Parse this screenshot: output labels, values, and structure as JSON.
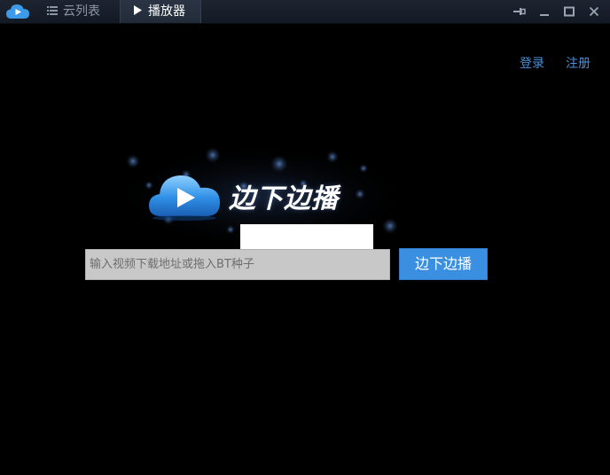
{
  "titlebar": {
    "logo_icon": "cloud-play-icon",
    "tabs": [
      {
        "label": "云列表",
        "icon": "list-icon",
        "active": false
      },
      {
        "label": "播放器",
        "icon": "play-icon",
        "active": true
      }
    ],
    "window_controls": [
      "pin-icon",
      "minimize-icon",
      "maximize-icon",
      "close-icon"
    ]
  },
  "header": {
    "login_label": "登录",
    "register_label": "注册"
  },
  "brand": {
    "logo_icon": "cloud-play-icon",
    "name": "边下边播"
  },
  "search": {
    "placeholder": "输入视频下载地址或拖入BT种子",
    "value": "",
    "button_label": "边下边播"
  },
  "colors": {
    "background": "#000000",
    "accent": "#3b8fe0",
    "link": "#4a8fd8",
    "titlebar": "#1d2430"
  }
}
